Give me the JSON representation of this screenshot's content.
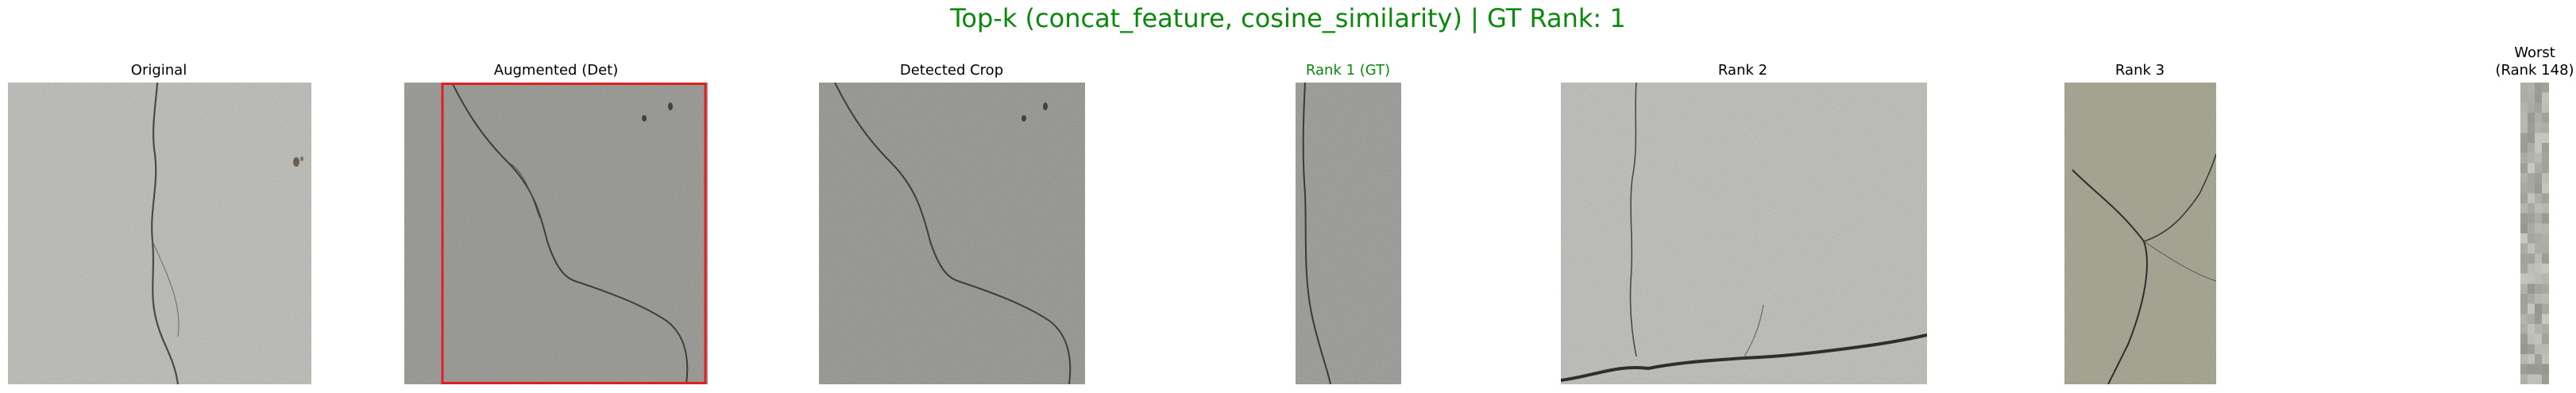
{
  "figure": {
    "title": "Top-k (concat_feature, cosine_similarity) | GT Rank: 1",
    "title_color": "#0a8a0a"
  },
  "panels": [
    {
      "id": "original",
      "title": "Original",
      "image": "concrete-wall-crack-photo"
    },
    {
      "id": "augmented",
      "title": "Augmented (Det)",
      "image": "concrete-wall-crack-photo-augmented",
      "detection_box_color": "#e02020"
    },
    {
      "id": "detected",
      "title": "Detected Crop",
      "image": "concrete-wall-crack-photo-cropped"
    },
    {
      "id": "rank1",
      "title": "Rank 1 (GT)",
      "image": "concrete-wall-crack-narrow-strip",
      "title_color": "#0a8a0a"
    },
    {
      "id": "rank2",
      "title": "Rank 2",
      "image": "concrete-wall-long-horizontal-crack"
    },
    {
      "id": "rank3",
      "title": "Rank 3",
      "image": "concrete-wall-branching-crack"
    },
    {
      "id": "worst",
      "title_line1": "Worst",
      "title_line2": "(Rank 148)",
      "image": "pixelated-gray-strip"
    }
  ]
}
